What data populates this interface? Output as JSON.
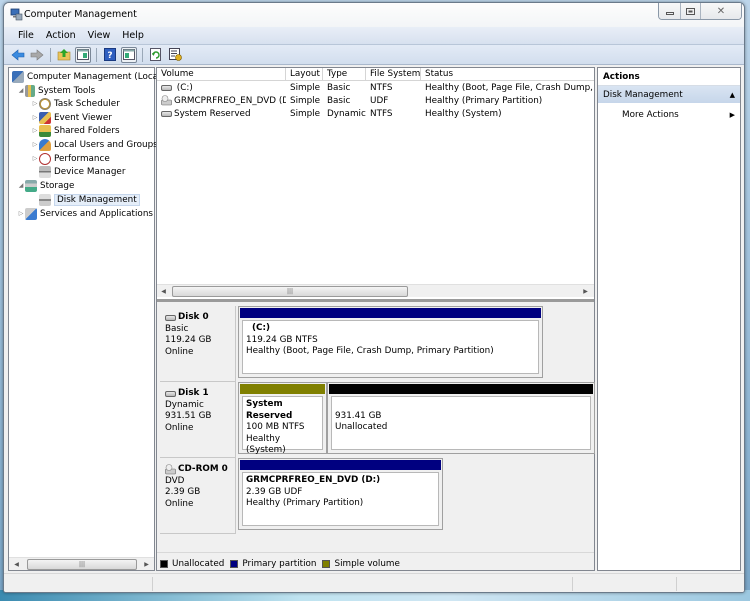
{
  "window": {
    "title": "Computer Management",
    "controls": {
      "minimize": "minimize",
      "maximize": "maximize",
      "close": "close"
    }
  },
  "menu": [
    "File",
    "Action",
    "View",
    "Help"
  ],
  "toolbar": [
    {
      "icon": "back-arrow-icon"
    },
    {
      "icon": "forward-arrow-icon"
    },
    {
      "icon": "up-folder-icon"
    },
    {
      "icon": "show-hide-console-tree-icon"
    },
    {
      "icon": "help-icon"
    },
    {
      "icon": "show-hide-action-pane-icon"
    },
    {
      "icon": "refresh-icon"
    },
    {
      "icon": "properties-icon"
    }
  ],
  "tree": {
    "items": [
      {
        "label": "Computer Management (Local",
        "level": 0,
        "arrow": "",
        "icon": "computer-management-icon"
      },
      {
        "label": "System Tools",
        "level": 1,
        "arrow": "expanded",
        "icon": "system-tools-icon"
      },
      {
        "label": "Task Scheduler",
        "level": 2,
        "arrow": "collapsed",
        "icon": "task-scheduler-icon"
      },
      {
        "label": "Event Viewer",
        "level": 2,
        "arrow": "collapsed",
        "icon": "event-viewer-icon"
      },
      {
        "label": "Shared Folders",
        "level": 2,
        "arrow": "collapsed",
        "icon": "shared-folders-icon"
      },
      {
        "label": "Local Users and Groups",
        "level": 2,
        "arrow": "collapsed",
        "icon": "local-users-icon"
      },
      {
        "label": "Performance",
        "level": 2,
        "arrow": "collapsed",
        "icon": "performance-icon"
      },
      {
        "label": "Device Manager",
        "level": 2,
        "arrow": "",
        "icon": "device-manager-icon"
      },
      {
        "label": "Storage",
        "level": 1,
        "arrow": "expanded",
        "icon": "storage-icon"
      },
      {
        "label": "Disk Management",
        "level": 2,
        "arrow": "",
        "icon": "disk-management-icon",
        "selected": true
      },
      {
        "label": "Services and Applications",
        "level": 1,
        "arrow": "collapsed",
        "icon": "services-icon"
      }
    ]
  },
  "volumes": {
    "columns": [
      "Volume",
      "Layout",
      "Type",
      "File System",
      "Status"
    ],
    "rows": [
      {
        "volume": "(C:)",
        "layout": "Simple",
        "type": "Basic",
        "fs": "NTFS",
        "status": "Healthy (Boot, Page File, Crash Dump, Prir",
        "icon": "drive-icon"
      },
      {
        "volume": "GRMCPRFREO_EN_DVD (D:)",
        "layout": "Simple",
        "type": "Basic",
        "fs": "UDF",
        "status": "Healthy (Primary Partition)",
        "icon": "dvd-icon"
      },
      {
        "volume": "System Reserved",
        "layout": "Simple",
        "type": "Dynamic",
        "fs": "NTFS",
        "status": "Healthy (System)",
        "icon": "drive-icon"
      }
    ]
  },
  "disks": [
    {
      "name": "Disk 0",
      "kind": "Basic",
      "size": "119.24 GB",
      "state": "Online",
      "partitions": [
        {
          "title": "(C:)",
          "line1": "119.24 GB NTFS",
          "line2": "Healthy (Boot, Page File, Crash Dump, Primary Partition)",
          "color": "#000080"
        }
      ]
    },
    {
      "name": "Disk 1",
      "kind": "Dynamic",
      "size": "931.51 GB",
      "state": "Online",
      "partitions": [
        {
          "title": "System Reserved",
          "line1": "100 MB NTFS",
          "line2": "Healthy (System)",
          "color": "#808000"
        },
        {
          "title": "",
          "line1": "931.41 GB",
          "line2": "Unallocated",
          "color": "#000000"
        }
      ]
    },
    {
      "name": "CD-ROM 0",
      "kind": "DVD",
      "size": "2.39 GB",
      "state": "Online",
      "partitions": [
        {
          "title": "GRMCPRFREO_EN_DVD  (D:)",
          "line1": "2.39 GB UDF",
          "line2": "Healthy (Primary Partition)",
          "color": "#000080"
        }
      ]
    }
  ],
  "legend": [
    {
      "label": "Unallocated",
      "color": "#000000"
    },
    {
      "label": "Primary partition",
      "color": "#000080"
    },
    {
      "label": "Simple volume",
      "color": "#808000"
    }
  ],
  "actions": {
    "header": "Actions",
    "section": "Disk Management",
    "item": "More Actions"
  }
}
